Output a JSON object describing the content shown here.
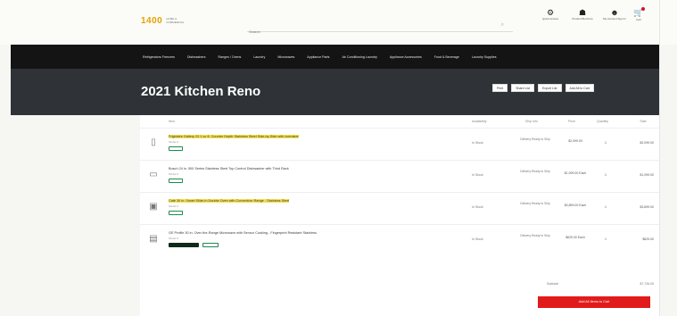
{
  "header": {
    "logo_mark": "1400",
    "logo_sub": "HOME & COMMERCIAL",
    "search_placeholder": "Search",
    "icons": [
      {
        "icon": "gear-icon",
        "glyph": "⚙",
        "label": "Quick Access"
      },
      {
        "icon": "person-icon",
        "glyph": "☗",
        "label": "Product Brochure"
      },
      {
        "icon": "user-icon",
        "glyph": "☻",
        "label": "My Account Sign In"
      }
    ],
    "cart": {
      "icon": "cart-icon",
      "glyph": "🛒",
      "label": "Cart"
    }
  },
  "nav": {
    "items": [
      "Refrigerators Freezers",
      "Dishwashers",
      "Ranges / Ovens",
      "Laundry",
      "Microwaves",
      "Appliance Parts",
      "Air Conditioning Laundry",
      "Appliance Accessories",
      "Food & Beverage",
      "Laundry Supplies"
    ]
  },
  "page": {
    "title": "2021 Kitchen Reno",
    "actions": [
      "Print",
      "Share List",
      "Export List",
      "Add All to Cart"
    ]
  },
  "table": {
    "headers": {
      "item": "Item",
      "availability": "Availability",
      "shipping": "Ship Info",
      "price": "Price",
      "quantity": "Quantity",
      "total": "Total"
    },
    "rows": [
      {
        "thumb_icon": "fridge-thumb-icon",
        "thumb_glyph": "▯",
        "name": "Frigidaire Gallery 22.1 cu ft. Counter Depth Stainless Steel Side-by-Side with Icemaker",
        "sku": "Model #:",
        "tags": [
          {
            "style": "green"
          }
        ],
        "availability": "In Stock",
        "ship": "Delivery Ready to Ship",
        "price": "$2,099.00",
        "qty": "1",
        "total": "$2,099.00"
      },
      {
        "thumb_icon": "dishwasher-thumb-icon",
        "thumb_glyph": "▭",
        "name": "Bosch 24 in. 500 Series Stainless Steel Top Control Dishwasher with Third Rack",
        "sku": "Model #:",
        "tags": [
          {
            "style": "green"
          }
        ],
        "availability": "In Stock",
        "ship": "Delivery Ready to Ship",
        "price": "$1,099.00 Each",
        "qty": "1",
        "total": "$1,099.00"
      },
      {
        "thumb_icon": "range-thumb-icon",
        "thumb_glyph": "▣",
        "name": "Café 30 in. Smart Slide-In Double Oven with Convection Range - Stainless Steel",
        "sku": "Model #:",
        "tags": [
          {
            "style": "green"
          }
        ],
        "availability": "In Stock",
        "ship": "Delivery Ready to Ship",
        "price": "$3,899.00 Each",
        "qty": "1",
        "total": "$3,899.00"
      },
      {
        "thumb_icon": "microwave-thumb-icon",
        "thumb_glyph": "▤",
        "name": "GE Profile 30 in. Over-the-Range Microwave with Sensor Cooking - Fingerprint Resistant Stainless",
        "sku": "Model #:",
        "tags": [
          {
            "style": "dark"
          },
          {
            "style": "green"
          }
        ],
        "availability": "In Stock",
        "ship": "Delivery Ready to Ship",
        "price": "$629.00 Each",
        "qty": "1",
        "total": "$629.00"
      }
    ]
  },
  "summary": {
    "subtotal_label": "Subtotal",
    "subtotal_value": "$7,726.00",
    "add_all_label": "Add All Items to Cart"
  },
  "colors": {
    "accent": "#e11b1b",
    "logo": "#e2a400",
    "nav_bg": "#141414",
    "banner_bg": "#2f3337",
    "tag_green": "#1c8a50"
  }
}
